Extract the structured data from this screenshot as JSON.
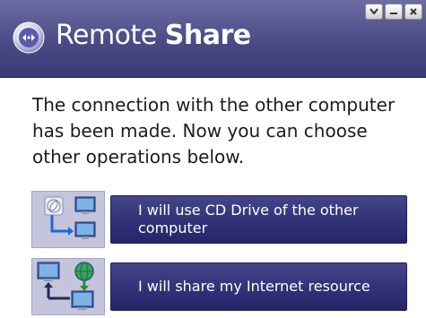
{
  "window": {
    "title_light": "Remote ",
    "title_bold": "Share",
    "controls": [
      "dropdown",
      "minimize",
      "close"
    ]
  },
  "message": "The connection with the other computer has been made. Now you can choose other operations below.",
  "options": [
    {
      "label": "I will use CD Drive of the other computer",
      "icon": "cd-drive-transfer-icon"
    },
    {
      "label": "I will share my Internet resource",
      "icon": "internet-share-icon"
    }
  ],
  "colors": {
    "titlebar": "#4a4a86",
    "button": "#33337a",
    "icon_panel": "#c4c4dc"
  }
}
